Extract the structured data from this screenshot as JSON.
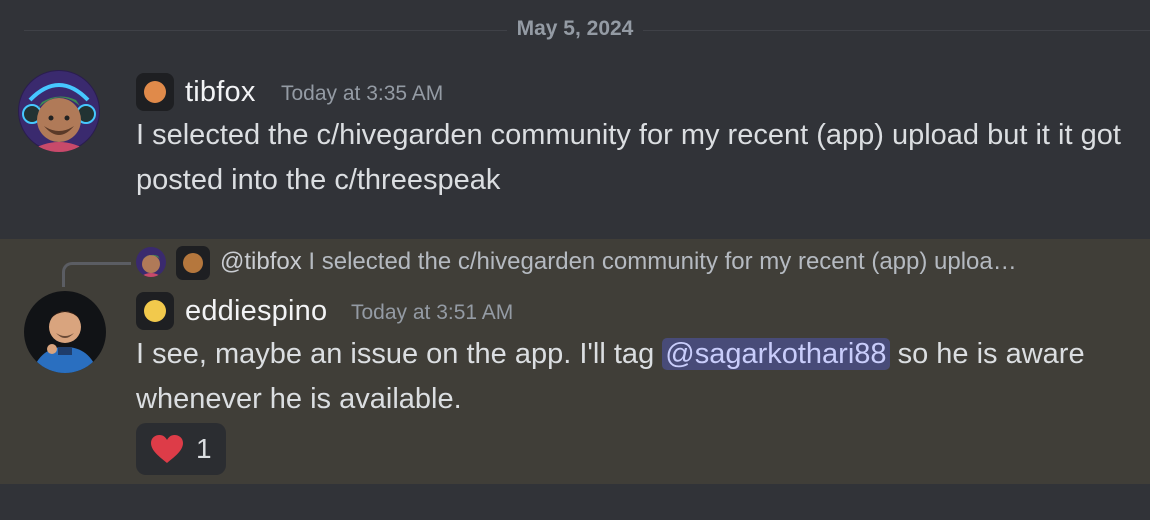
{
  "date_divider": "May 5, 2024",
  "messages": [
    {
      "username": "tibfox",
      "timestamp": "Today at 3:35 AM",
      "badge_color": "#e08a4a",
      "content": "I selected the c/hivegarden community for my recent (app) upload but it it got posted into the c/threespeak"
    },
    {
      "username": "eddiespino",
      "timestamp": "Today at 3:51 AM",
      "badge_color": "#f2c94c",
      "content_before": "I see, maybe an issue on the app. I'll tag ",
      "mention": "@sagarkothari88",
      "content_after": " so he is aware whenever he is available.",
      "reply": {
        "user": "@tibfox",
        "text": "I selected the c/hivegarden community for my recent (app) uploa…",
        "badge_color": "#b5773d"
      },
      "reaction": {
        "emoji": "heart-icon",
        "count": "1",
        "color": "#dd3c48"
      }
    }
  ]
}
